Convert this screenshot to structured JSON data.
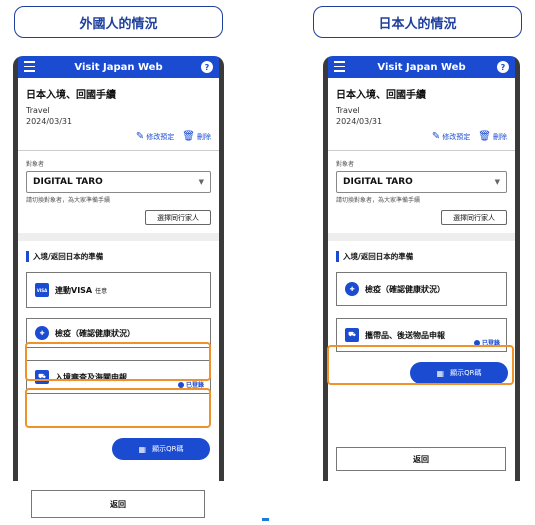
{
  "labels": {
    "left": "外國人的情況",
    "right": "日本人的情況"
  },
  "app": {
    "title": "Visit Japan Web",
    "help": "?",
    "procedure_title": "日本入境、回國手續",
    "purpose": "Travel",
    "date": "2024/03/31",
    "edit": "修改預定",
    "delete": "刪除",
    "target_label": "對象者",
    "target_value": "DIGITAL TARO",
    "target_hint": "請切換對象者，為大家準備手續",
    "companion_button": "選擇同行家人",
    "section": "入境/返回日本的準備",
    "visa": "連動VISA",
    "visa_optional": "任意",
    "visa_badge": "VISA",
    "quarantine": "檢疫（確認健康狀況）",
    "immigration_customs": "入境審查及海關申報",
    "customs_baggage": "攜帶品、後送物品申報",
    "registered": "已登錄",
    "qr_button": "顯示QR碼",
    "back": "返回"
  },
  "colors": {
    "brand": "#1b4bd1",
    "highlight": "#f0922b",
    "label": "#1e3f9c"
  },
  "icons": [
    "menu-icon",
    "help-icon",
    "edit-pencil-icon",
    "trash-icon",
    "chevron-down-icon",
    "visa-icon",
    "quarantine-icon",
    "immigration-icon",
    "baggage-icon",
    "qr-code-icon",
    "registered-dot-icon"
  ]
}
